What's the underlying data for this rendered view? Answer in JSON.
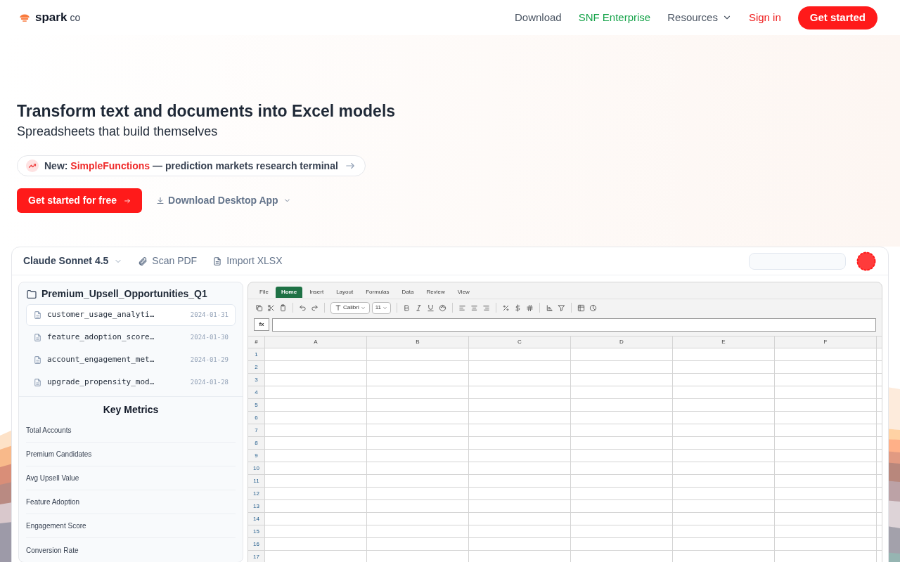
{
  "nav": {
    "brand": "spark",
    "brand_suffix": "co",
    "links": [
      {
        "label": "Download",
        "kind": "plain"
      },
      {
        "label": "SNF Enterprise",
        "kind": "enterprise"
      },
      {
        "label": "Resources",
        "kind": "dropdown"
      },
      {
        "label": "Sign in",
        "kind": "signin"
      }
    ],
    "cta": "Get started"
  },
  "hero": {
    "title": "Transform text and documents into Excel models",
    "subtitle": "Spreadsheets that build themselves",
    "announcement": {
      "prefix": "New:",
      "highlight": "SimpleFunctions",
      "rest": "— prediction markets research terminal"
    },
    "primary_button": "Get started for free",
    "secondary_button": "Download Desktop App"
  },
  "app": {
    "model": "Claude Sonnet 4.5",
    "tools": [
      {
        "label": "Scan PDF",
        "kind": "clip"
      },
      {
        "label": "Import XLSX",
        "kind": "sheet"
      }
    ],
    "folder": "Premium_Upsell_Opportunities_Q1",
    "files": [
      {
        "name": "customer_usage_analyti…",
        "date": "2024-01-31",
        "selected": true
      },
      {
        "name": "feature_adoption_score…",
        "date": "2024-01-30",
        "selected": false
      },
      {
        "name": "account_engagement_met…",
        "date": "2024-01-29",
        "selected": false
      },
      {
        "name": "upgrade_propensity_mod…",
        "date": "2024-01-28",
        "selected": false
      }
    ],
    "metrics_title": "Key Metrics",
    "metrics": [
      "Total Accounts",
      "Premium Candidates",
      "Avg Upsell Value",
      "Feature Adoption",
      "Engagement Score",
      "Conversion Rate"
    ],
    "sheet": {
      "menu": [
        {
          "label": "File",
          "selected": false
        },
        {
          "label": "Home",
          "selected": true
        },
        {
          "label": "Insert",
          "selected": false
        },
        {
          "label": "Layout",
          "selected": false
        },
        {
          "label": "Formulas",
          "selected": false
        },
        {
          "label": "Data",
          "selected": false
        },
        {
          "label": "Review",
          "selected": false
        },
        {
          "label": "View",
          "selected": false
        }
      ],
      "font": "Calibri",
      "font_size": "11",
      "formula_label": "fx",
      "corner": "#",
      "columns": [
        "A",
        "B",
        "C",
        "D",
        "E",
        "F"
      ],
      "rows": [
        "1",
        "2",
        "3",
        "4",
        "5",
        "6",
        "7",
        "8",
        "9",
        "10",
        "11",
        "12",
        "13",
        "14",
        "15",
        "16",
        "17"
      ]
    }
  }
}
